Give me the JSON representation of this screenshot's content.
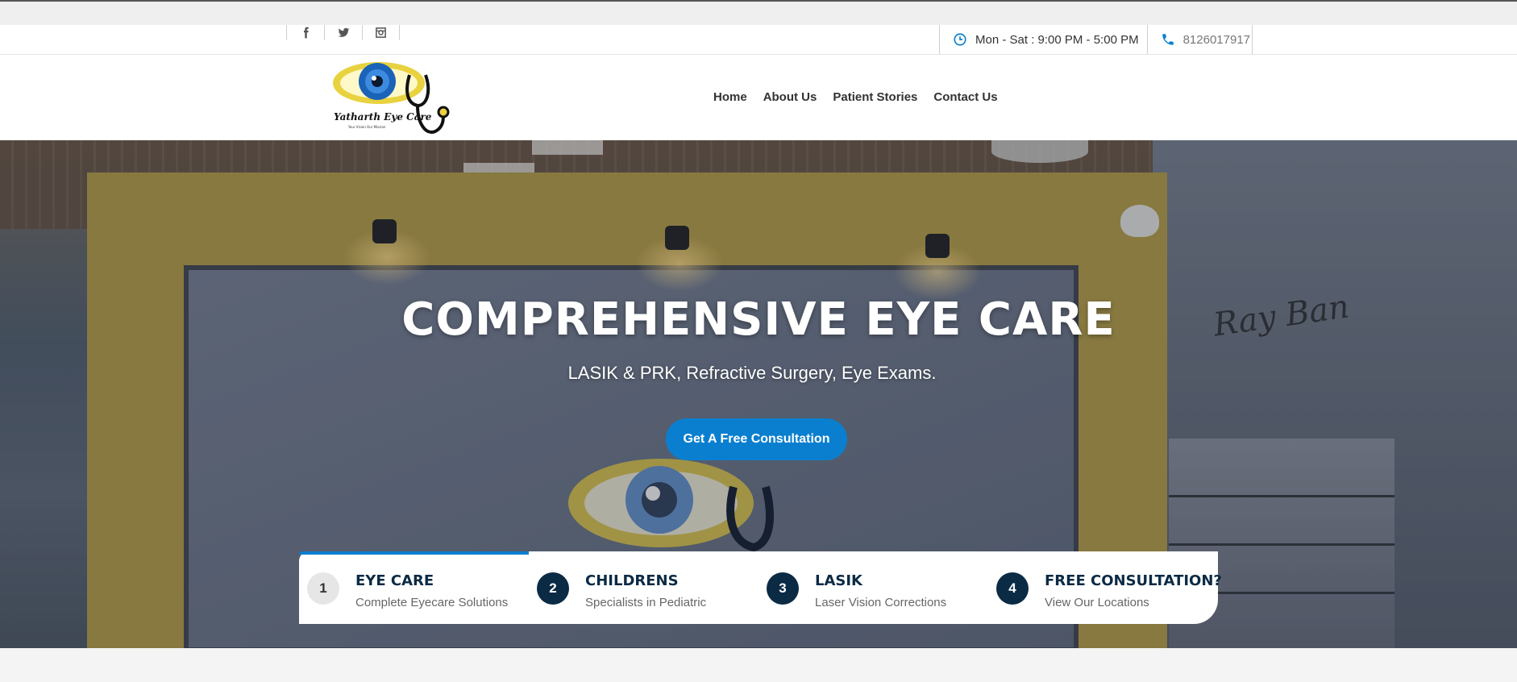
{
  "topbar": {
    "social": [
      {
        "name": "facebook-icon"
      },
      {
        "name": "twitter-icon"
      },
      {
        "name": "instagram-icon"
      }
    ],
    "hours": "Mon - Sat : 9:00 PM - 5:00 PM",
    "phone": "8126017917",
    "icon_color": "#0a7fcf"
  },
  "header": {
    "logo": {
      "brand": "Yatharth Eye Care",
      "tagline": "Your Vision Our Mission"
    },
    "nav": [
      "Home",
      "About Us",
      "Patient Stories",
      "Contact Us"
    ]
  },
  "hero": {
    "title": "COMPREHENSIVE EYE CARE",
    "subtitle": "LASIK & PRK, Refractive Surgery, Eye Exams.",
    "cta": "Get A Free Consultation",
    "accent_color": "#0a7fcf",
    "features": [
      {
        "num": "1",
        "title": "EYE CARE",
        "subtitle": "Complete Eyecare Solutions",
        "active": true
      },
      {
        "num": "2",
        "title": "CHILDRENS",
        "subtitle": "Specialists in Pediatric",
        "active": false
      },
      {
        "num": "3",
        "title": "LASIK",
        "subtitle": "Laser Vision Corrections",
        "active": false
      },
      {
        "num": "4",
        "title": "FREE CONSULTATION?",
        "subtitle": "View Our Locations",
        "active": false
      }
    ]
  }
}
